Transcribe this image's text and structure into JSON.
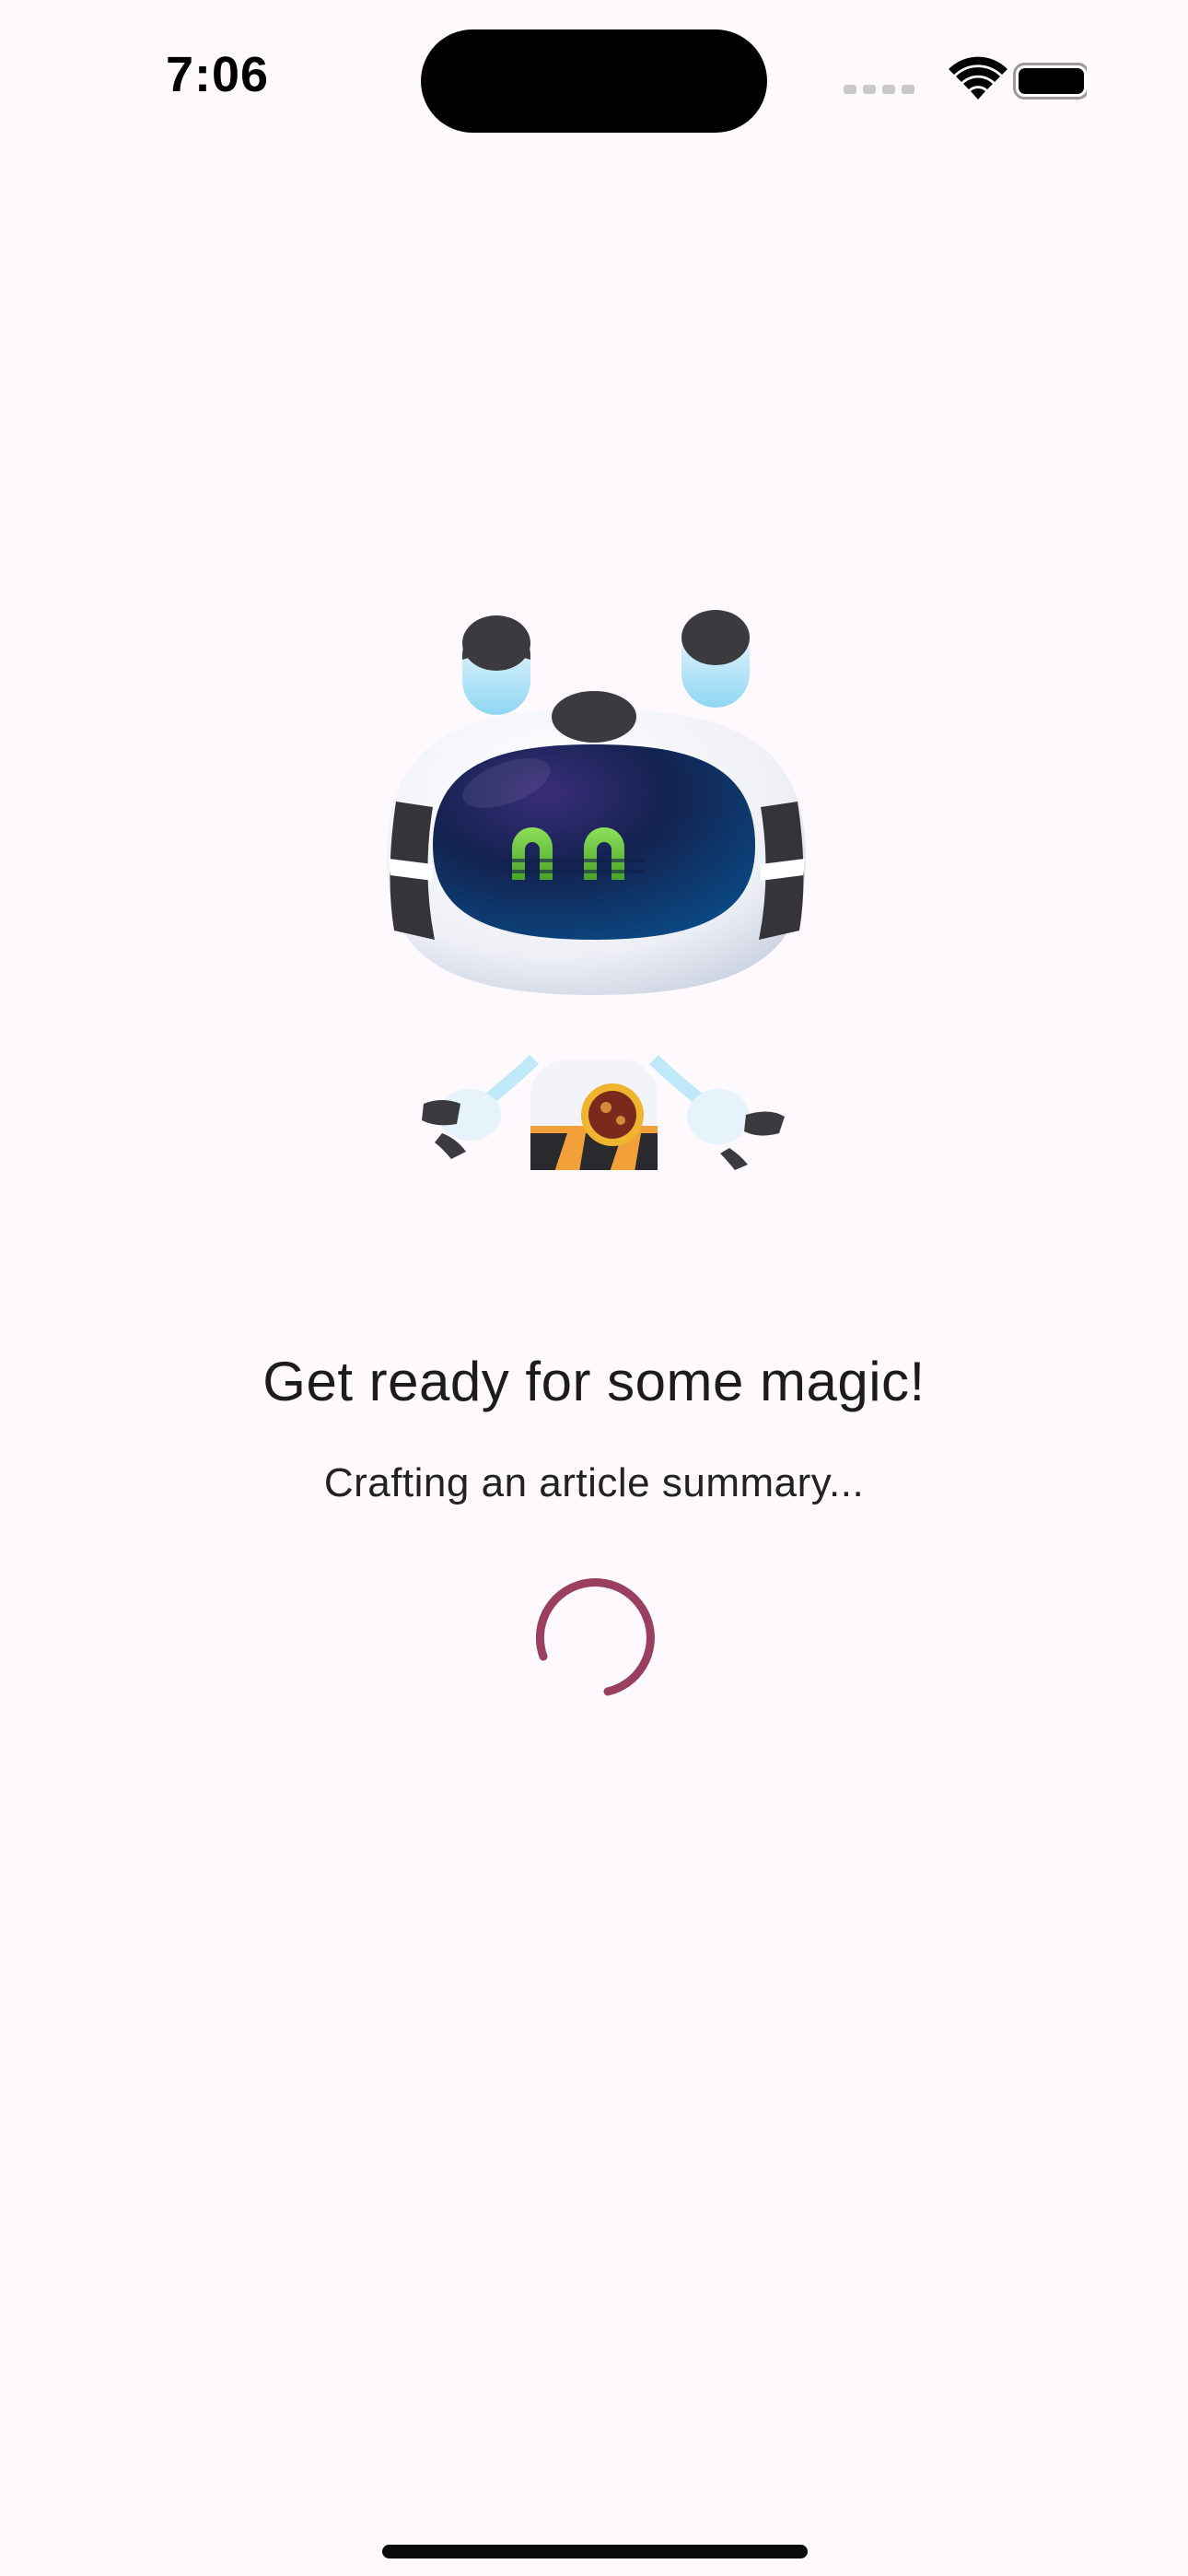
{
  "status_bar": {
    "time": "7:06",
    "icons": [
      "cellular-signal-icon",
      "wifi-icon",
      "battery-icon"
    ]
  },
  "loading": {
    "headline": "Get ready for some magic!",
    "subtext": "Crafting an article summary...",
    "spinner_color": "#9b3f5f"
  },
  "colors": {
    "background": "#fdf9fc",
    "mascot_eyes": "#7ed44a",
    "mascot_visor": "#0f1f4a"
  }
}
